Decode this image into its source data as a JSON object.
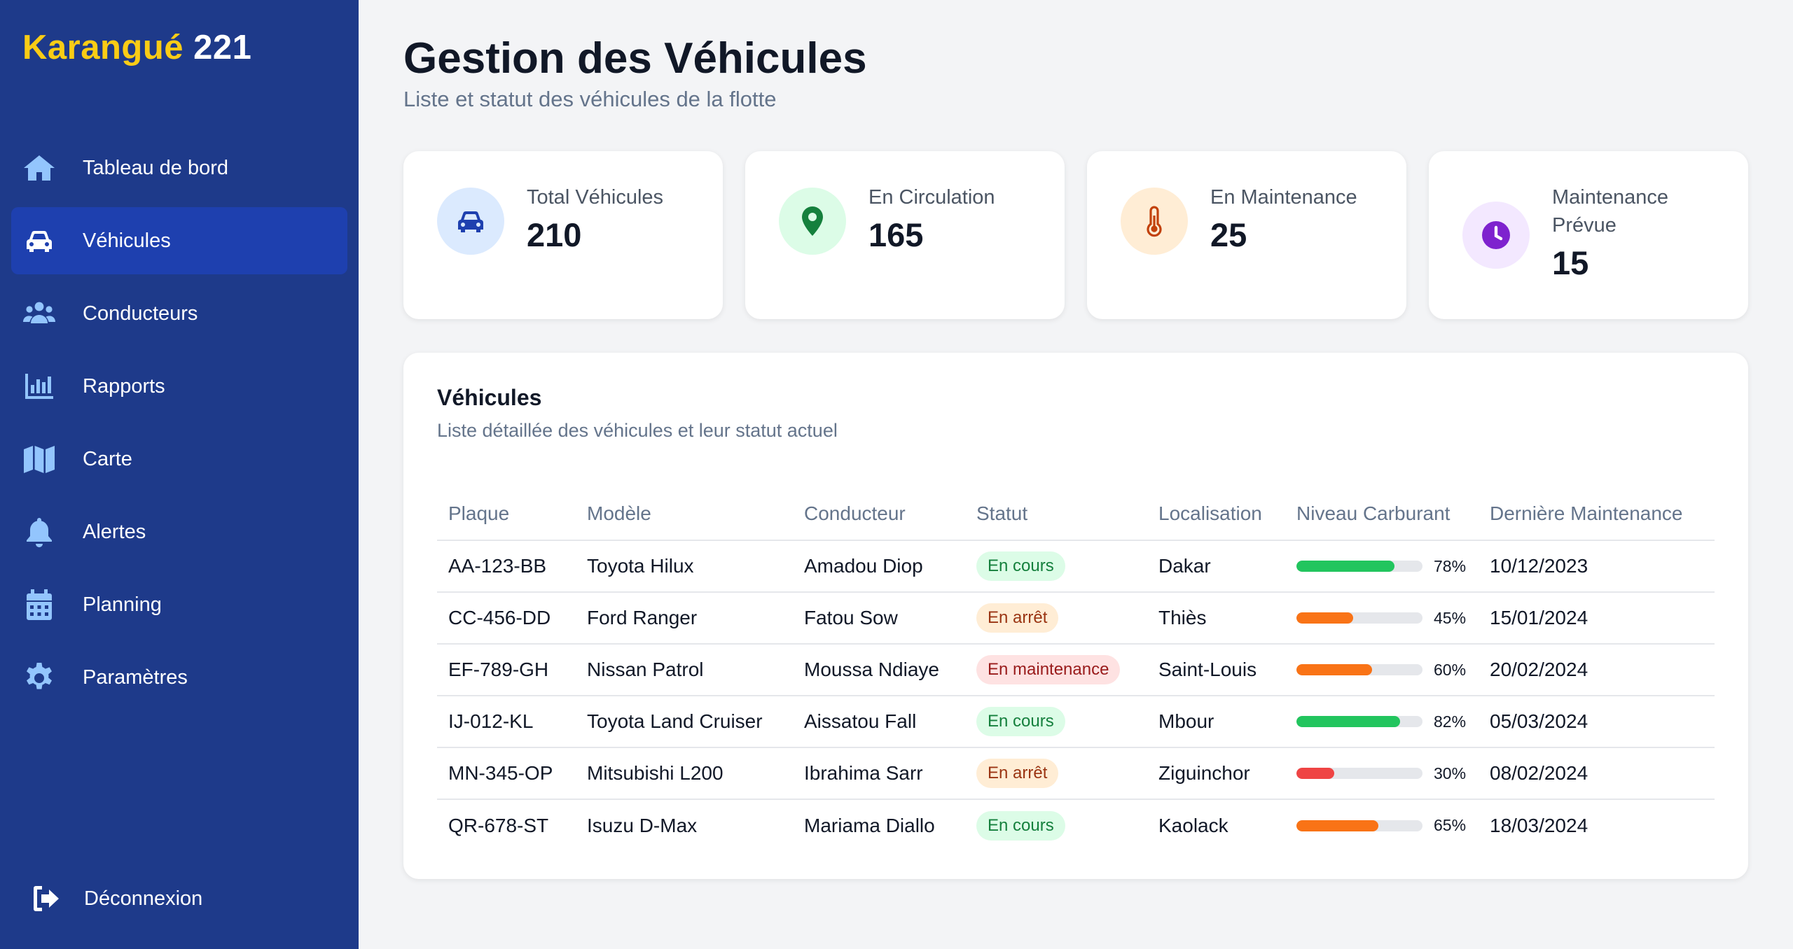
{
  "brand": {
    "part1": "Karangué",
    "part2": "221"
  },
  "sidebar": {
    "items": [
      {
        "label": "Tableau de bord",
        "icon": "home-icon"
      },
      {
        "label": "Véhicules",
        "icon": "car-icon",
        "active": true
      },
      {
        "label": "Conducteurs",
        "icon": "users-icon"
      },
      {
        "label": "Rapports",
        "icon": "chart-bar-icon"
      },
      {
        "label": "Carte",
        "icon": "map-icon"
      },
      {
        "label": "Alertes",
        "icon": "bell-icon"
      },
      {
        "label": "Planning",
        "icon": "calendar-icon"
      },
      {
        "label": "Paramètres",
        "icon": "gear-icon"
      }
    ],
    "logout": "Déconnexion"
  },
  "header": {
    "title": "Gestion des Véhicules",
    "subtitle": "Liste et statut des véhicules de la flotte"
  },
  "stats": [
    {
      "label": "Total Véhicules",
      "value": "210",
      "icon": "car-icon",
      "icon_color": "#1e40af",
      "bg": "#dbeafe"
    },
    {
      "label": "En Circulation",
      "value": "165",
      "icon": "map-pin-icon",
      "icon_color": "#15803d",
      "bg": "#dcfce7"
    },
    {
      "label": "En Maintenance",
      "value": "25",
      "icon": "thermometer-icon",
      "icon_color": "#c2410c",
      "bg": "#ffedd5"
    },
    {
      "label": "Maintenance Prévue",
      "value": "15",
      "icon": "clock-icon",
      "icon_color": "#7e22ce",
      "bg": "#f3e8ff"
    }
  ],
  "table": {
    "title": "Véhicules",
    "subtitle": "Liste détaillée des véhicules et leur statut actuel",
    "columns": [
      "Plaque",
      "Modèle",
      "Conducteur",
      "Statut",
      "Localisation",
      "Niveau Carburant",
      "Dernière Maintenance"
    ],
    "rows": [
      {
        "plaque": "AA-123-BB",
        "modele": "Toyota Hilux",
        "conducteur": "Amadou Diop",
        "statut": "En cours",
        "statut_type": "green",
        "localisation": "Dakar",
        "carburant": 78,
        "carburant_label": "78%",
        "carburant_color": "#22c55e",
        "maintenance": "10/12/2023"
      },
      {
        "plaque": "CC-456-DD",
        "modele": "Ford Ranger",
        "conducteur": "Fatou Sow",
        "statut": "En arrêt",
        "statut_type": "orange",
        "localisation": "Thiès",
        "carburant": 45,
        "carburant_label": "45%",
        "carburant_color": "#f97316",
        "maintenance": "15/01/2024"
      },
      {
        "plaque": "EF-789-GH",
        "modele": "Nissan Patrol",
        "conducteur": "Moussa Ndiaye",
        "statut": "En maintenance",
        "statut_type": "red",
        "localisation": "Saint-Louis",
        "carburant": 60,
        "carburant_label": "60%",
        "carburant_color": "#f97316",
        "maintenance": "20/02/2024"
      },
      {
        "plaque": "IJ-012-KL",
        "modele": "Toyota Land Cruiser",
        "conducteur": "Aissatou Fall",
        "statut": "En cours",
        "statut_type": "green",
        "localisation": "Mbour",
        "carburant": 82,
        "carburant_label": "82%",
        "carburant_color": "#22c55e",
        "maintenance": "05/03/2024"
      },
      {
        "plaque": "MN-345-OP",
        "modele": "Mitsubishi L200",
        "conducteur": "Ibrahima Sarr",
        "statut": "En arrêt",
        "statut_type": "orange",
        "localisation": "Ziguinchor",
        "carburant": 30,
        "carburant_label": "30%",
        "carburant_color": "#ef4444",
        "maintenance": "08/02/2024"
      },
      {
        "plaque": "QR-678-ST",
        "modele": "Isuzu D-Max",
        "conducteur": "Mariama Diallo",
        "statut": "En cours",
        "statut_type": "green",
        "localisation": "Kaolack",
        "carburant": 65,
        "carburant_label": "65%",
        "carburant_color": "#f97316",
        "maintenance": "18/03/2024"
      }
    ]
  }
}
